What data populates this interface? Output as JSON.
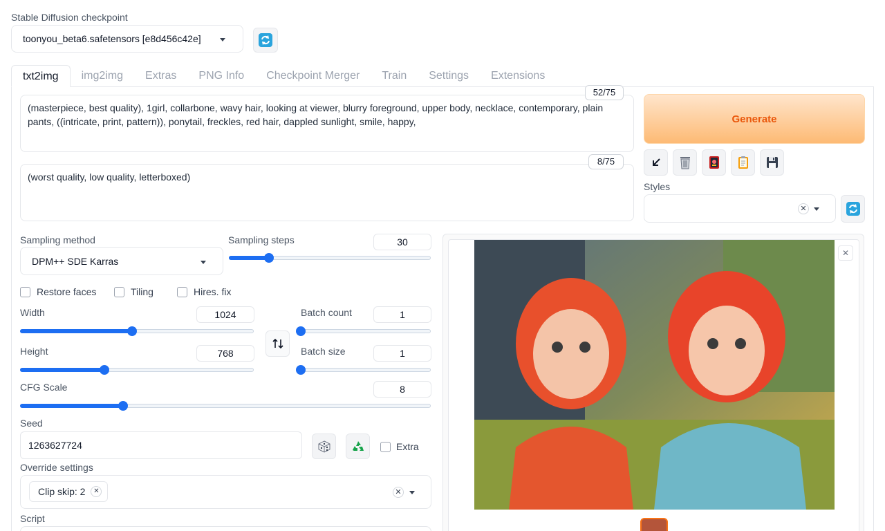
{
  "checkpoint": {
    "label": "Stable Diffusion checkpoint",
    "value": "toonyou_beta6.safetensors [e8d456c42e]"
  },
  "tabs": [
    {
      "label": "txt2img",
      "active": true
    },
    {
      "label": "img2img"
    },
    {
      "label": "Extras"
    },
    {
      "label": "PNG Info"
    },
    {
      "label": "Checkpoint Merger"
    },
    {
      "label": "Train"
    },
    {
      "label": "Settings"
    },
    {
      "label": "Extensions"
    }
  ],
  "prompt": {
    "counter": "52/75",
    "text": "(masterpiece, best quality), 1girl, collarbone, wavy hair, looking at viewer, blurry foreground, upper body, necklace, contemporary, plain pants, ((intricate, print, pattern)), ponytail, freckles, red hair, dappled sunlight, smile, happy,"
  },
  "negative_prompt": {
    "counter": "8/75",
    "text": "(worst quality, low quality, letterboxed)"
  },
  "generate_label": "Generate",
  "styles": {
    "label": "Styles",
    "value": ""
  },
  "sampling_method": {
    "label": "Sampling method",
    "value": "DPM++ SDE Karras"
  },
  "sampling_steps": {
    "label": "Sampling steps",
    "value": "30",
    "fraction": 0.2
  },
  "checkboxes": {
    "restore_faces": "Restore faces",
    "tiling": "Tiling",
    "hires_fix": "Hires. fix"
  },
  "width": {
    "label": "Width",
    "value": "1024",
    "fraction": 0.48
  },
  "height": {
    "label": "Height",
    "value": "768",
    "fraction": 0.36
  },
  "batch_count": {
    "label": "Batch count",
    "value": "1",
    "fraction": 0.0
  },
  "batch_size": {
    "label": "Batch size",
    "value": "1",
    "fraction": 0.0
  },
  "cfg_scale": {
    "label": "CFG Scale",
    "value": "8",
    "fraction": 0.25
  },
  "seed": {
    "label": "Seed",
    "value": "1263627724",
    "extra_label": "Extra"
  },
  "override": {
    "label": "Override settings",
    "chip": "Clip skip: 2"
  },
  "script": {
    "label": "Script"
  },
  "colors": {
    "accent": "#1d6ef2",
    "generate": "#ea580c"
  }
}
